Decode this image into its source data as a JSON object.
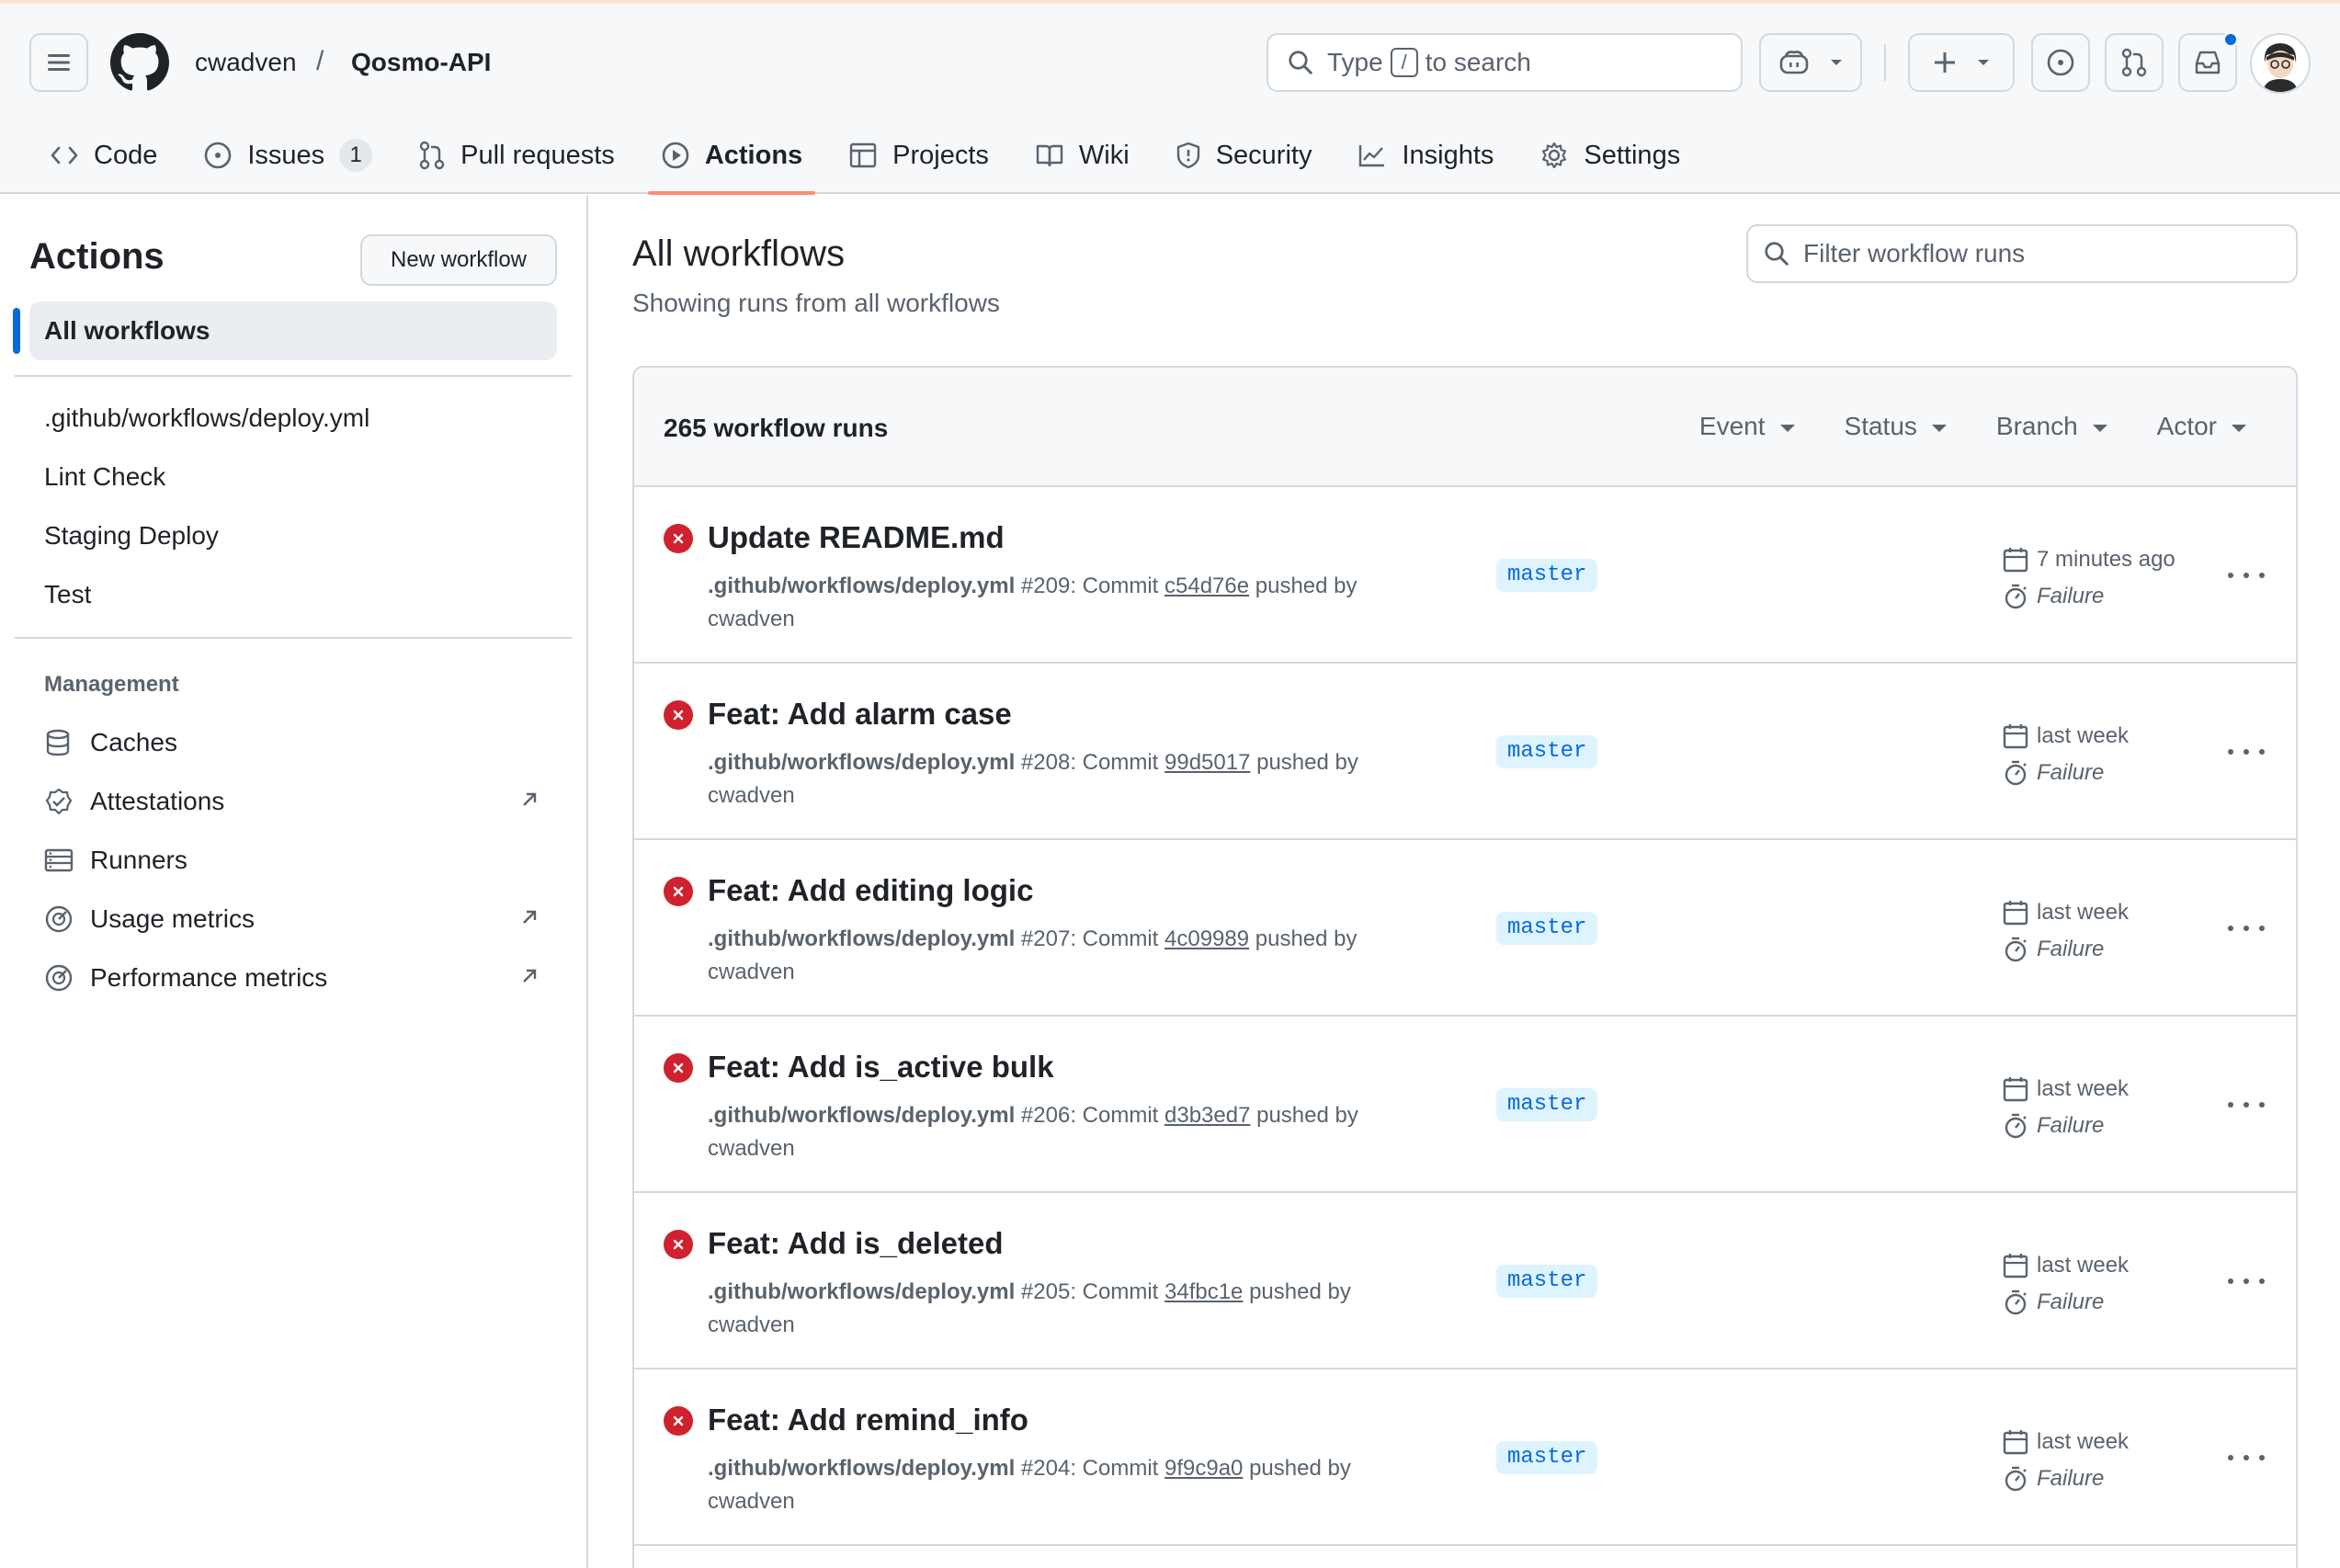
{
  "header": {
    "owner": "cwadven",
    "separator": "/",
    "repo": "Qosmo-API",
    "search": {
      "prefix": "Type",
      "key": "/",
      "suffix": "to search"
    }
  },
  "tabs": [
    {
      "label": "Code",
      "icon": "code-icon"
    },
    {
      "label": "Issues",
      "icon": "issue-icon",
      "counter": "1"
    },
    {
      "label": "Pull requests",
      "icon": "pull-request-icon"
    },
    {
      "label": "Actions",
      "icon": "play-icon",
      "active": true
    },
    {
      "label": "Projects",
      "icon": "table-icon"
    },
    {
      "label": "Wiki",
      "icon": "book-icon"
    },
    {
      "label": "Security",
      "icon": "shield-icon"
    },
    {
      "label": "Insights",
      "icon": "graph-icon"
    },
    {
      "label": "Settings",
      "icon": "gear-icon"
    }
  ],
  "sidebar": {
    "title": "Actions",
    "new_workflow": "New workflow",
    "active_item": "All workflows",
    "workflows": [
      ".github/workflows/deploy.yml",
      "Lint Check",
      "Staging Deploy",
      "Test"
    ],
    "management_heading": "Management",
    "management": [
      {
        "label": "Caches",
        "icon": "database-icon",
        "external": false
      },
      {
        "label": "Attestations",
        "icon": "verified-icon",
        "external": true
      },
      {
        "label": "Runners",
        "icon": "server-icon",
        "external": false
      },
      {
        "label": "Usage metrics",
        "icon": "meter-icon",
        "external": true
      },
      {
        "label": "Performance metrics",
        "icon": "meter-icon",
        "external": true
      }
    ]
  },
  "main": {
    "title": "All workflows",
    "subtitle": "Showing runs from all workflows",
    "filter_placeholder": "Filter workflow runs",
    "runs_count": "265 workflow runs",
    "filters": [
      "Event",
      "Status",
      "Branch",
      "Actor"
    ],
    "runs": [
      {
        "title": "Update README.md",
        "workflow": ".github/workflows/deploy.yml",
        "number": "#209",
        "commit_label": "Commit",
        "sha": "c54d76e",
        "pushed_by": "pushed by",
        "actor": "cwadven",
        "branch": "master",
        "when": "7 minutes ago",
        "status": "Failure"
      },
      {
        "title": "Feat: Add alarm case",
        "workflow": ".github/workflows/deploy.yml",
        "number": "#208",
        "commit_label": "Commit",
        "sha": "99d5017",
        "pushed_by": "pushed by",
        "actor": "cwadven",
        "branch": "master",
        "when": "last week",
        "status": "Failure"
      },
      {
        "title": "Feat: Add editing logic",
        "workflow": ".github/workflows/deploy.yml",
        "number": "#207",
        "commit_label": "Commit",
        "sha": "4c09989",
        "pushed_by": "pushed by",
        "actor": "cwadven",
        "branch": "master",
        "when": "last week",
        "status": "Failure"
      },
      {
        "title": "Feat: Add is_active bulk",
        "workflow": ".github/workflows/deploy.yml",
        "number": "#206",
        "commit_label": "Commit",
        "sha": "d3b3ed7",
        "pushed_by": "pushed by",
        "actor": "cwadven",
        "branch": "master",
        "when": "last week",
        "status": "Failure"
      },
      {
        "title": "Feat: Add is_deleted",
        "workflow": ".github/workflows/deploy.yml",
        "number": "#205",
        "commit_label": "Commit",
        "sha": "34fbc1e",
        "pushed_by": "pushed by",
        "actor": "cwadven",
        "branch": "master",
        "when": "last week",
        "status": "Failure"
      },
      {
        "title": "Feat: Add remind_info",
        "workflow": ".github/workflows/deploy.yml",
        "number": "#204",
        "commit_label": "Commit",
        "sha": "9f9c9a0",
        "pushed_by": "pushed by",
        "actor": "cwadven",
        "branch": "master",
        "when": "last week",
        "status": "Failure"
      }
    ]
  },
  "colors": {
    "accent": "#0969da",
    "failure": "#cf222e",
    "active_tab_underline": "#fd8c73",
    "branch_bg": "#ddf4ff"
  }
}
